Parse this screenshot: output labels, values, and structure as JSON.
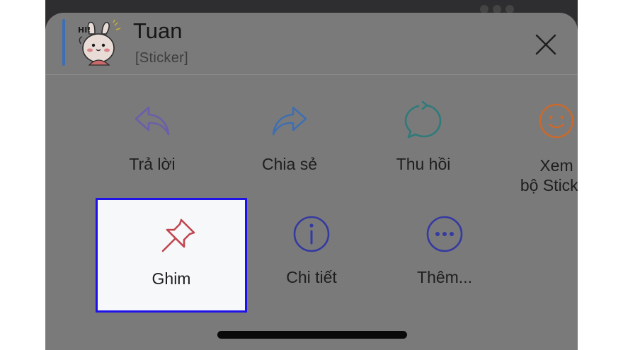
{
  "header": {
    "sender_name": "Tuan",
    "message_preview": "[Sticker]",
    "sticker_text": "HI!"
  },
  "actions_row1": [
    {
      "label": "Trả lời",
      "icon": "reply-arrow-icon",
      "color": "#6a5fa8"
    },
    {
      "label": "Chia sẻ",
      "icon": "share-arrow-icon",
      "color": "#3f6fb0"
    },
    {
      "label": "Thu hồi",
      "icon": "recall-bubble-icon",
      "color": "#2f7a7a"
    },
    {
      "label": "Xem\nbộ Sticker",
      "label_line1": "Xem",
      "label_line2": "bộ Sticker",
      "icon": "smiley-face-icon",
      "color": "#c86a2e"
    }
  ],
  "actions_row2": [
    {
      "label": "Ghim",
      "icon": "pin-icon",
      "color": "#c0464f"
    },
    {
      "label": "Chi tiết",
      "icon": "info-circle-icon",
      "color": "#343aa0"
    },
    {
      "label": "Thêm...",
      "icon": "more-dots-icon",
      "color": "#343aa0"
    }
  ],
  "colors": {
    "overlay_gray": "#7a7a7b",
    "highlight_border": "#1f12e6",
    "highlight_bg": "#f7f8fa",
    "accent_bar": "#3d6fb6"
  }
}
